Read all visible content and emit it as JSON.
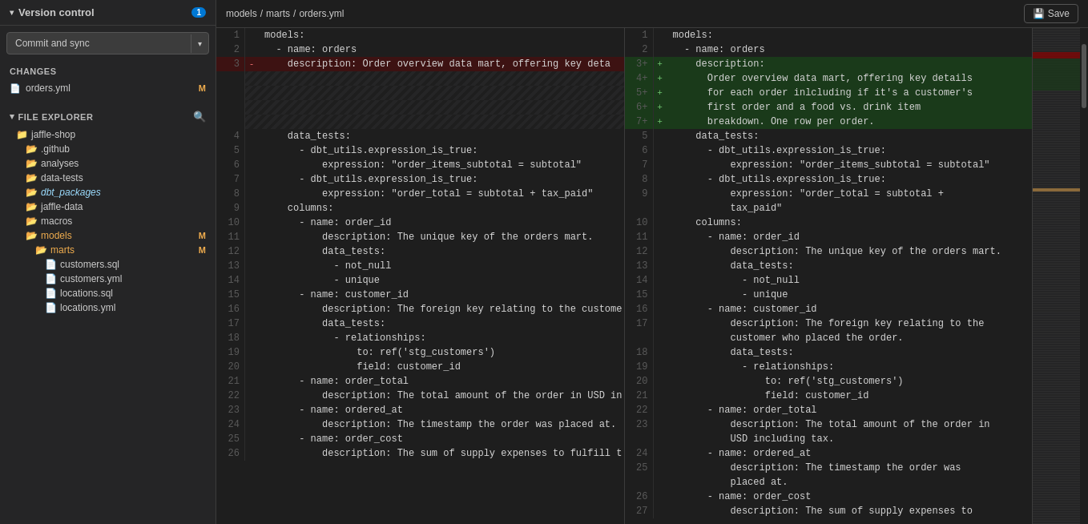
{
  "sidebar": {
    "title": "Version control",
    "badge": "1",
    "commit_button": "Commit and sync",
    "chevron": "▾",
    "changes_label": "Changes",
    "files": [
      {
        "name": "orders.yml",
        "badge": "M",
        "icon": "📄"
      }
    ]
  },
  "file_explorer": {
    "title": "File explorer",
    "search_icon": "🔍",
    "items": [
      {
        "label": "jaffle-shop",
        "type": "folder",
        "indent": 1
      },
      {
        "label": ".github",
        "type": "folder",
        "indent": 2
      },
      {
        "label": "analyses",
        "type": "folder",
        "indent": 2
      },
      {
        "label": "data-tests",
        "type": "folder",
        "indent": 2
      },
      {
        "label": "dbt_packages",
        "type": "folder",
        "indent": 2,
        "italic": true
      },
      {
        "label": "jaffle-data",
        "type": "folder",
        "indent": 2
      },
      {
        "label": "macros",
        "type": "folder",
        "indent": 2
      },
      {
        "label": "models",
        "type": "folder",
        "indent": 2,
        "badge": "M"
      },
      {
        "label": "marts",
        "type": "folder",
        "indent": 3,
        "badge": "M"
      },
      {
        "label": "customers.sql",
        "type": "sql",
        "indent": 4
      },
      {
        "label": "customers.yml",
        "type": "yaml",
        "indent": 4
      },
      {
        "label": "locations.sql",
        "type": "sql",
        "indent": 4
      },
      {
        "label": "locations.yml",
        "type": "yaml",
        "indent": 4
      }
    ]
  },
  "breadcrumb": {
    "parts": [
      "models",
      "marts",
      "orders.yml"
    ]
  },
  "save_button": "Save",
  "diff": {
    "left": {
      "lines": [
        {
          "num": 1,
          "content": "models:",
          "type": "normal"
        },
        {
          "num": 2,
          "content": "  - name: orders",
          "type": "normal"
        },
        {
          "num": 3,
          "content": "    description: Order overview data mart, offering key deta",
          "type": "removed",
          "marker": "-"
        },
        {
          "num": "",
          "content": "",
          "type": "placeholder"
        },
        {
          "num": "",
          "content": "",
          "type": "placeholder"
        },
        {
          "num": "",
          "content": "",
          "type": "placeholder"
        },
        {
          "num": "",
          "content": "",
          "type": "placeholder"
        },
        {
          "num": 4,
          "content": "    data_tests:",
          "type": "normal"
        },
        {
          "num": 5,
          "content": "      - dbt_utils.expression_is_true:",
          "type": "normal"
        },
        {
          "num": 6,
          "content": "          expression: \"order_items_subtotal = subtotal\"",
          "type": "normal"
        },
        {
          "num": 7,
          "content": "      - dbt_utils.expression_is_true:",
          "type": "normal"
        },
        {
          "num": 8,
          "content": "          expression: \"order_total = subtotal + tax_paid\"",
          "type": "normal"
        },
        {
          "num": 9,
          "content": "    columns:",
          "type": "normal"
        },
        {
          "num": 10,
          "content": "      - name: order_id",
          "type": "normal"
        },
        {
          "num": 11,
          "content": "          description: The unique key of the orders mart.",
          "type": "normal"
        },
        {
          "num": 12,
          "content": "          data_tests:",
          "type": "normal"
        },
        {
          "num": 13,
          "content": "            - not_null",
          "type": "normal"
        },
        {
          "num": 14,
          "content": "            - unique",
          "type": "normal"
        },
        {
          "num": 15,
          "content": "      - name: customer_id",
          "type": "normal"
        },
        {
          "num": 16,
          "content": "          description: The foreign key relating to the custome",
          "type": "normal"
        },
        {
          "num": 17,
          "content": "          data_tests:",
          "type": "normal"
        },
        {
          "num": 18,
          "content": "            - relationships:",
          "type": "normal"
        },
        {
          "num": 19,
          "content": "                to: ref('stg_customers')",
          "type": "normal"
        },
        {
          "num": 20,
          "content": "                field: customer_id",
          "type": "normal"
        },
        {
          "num": 21,
          "content": "      - name: order_total",
          "type": "normal"
        },
        {
          "num": 22,
          "content": "          description: The total amount of the order in USD in",
          "type": "normal"
        },
        {
          "num": 23,
          "content": "      - name: ordered_at",
          "type": "normal"
        },
        {
          "num": 24,
          "content": "          description: The timestamp the order was placed at.",
          "type": "normal"
        },
        {
          "num": 25,
          "content": "      - name: order_cost",
          "type": "normal"
        },
        {
          "num": 26,
          "content": "          description: The sum of supply expenses to fulfill t",
          "type": "normal"
        }
      ]
    },
    "right": {
      "lines": [
        {
          "num": 1,
          "content": "models:",
          "type": "normal"
        },
        {
          "num": 2,
          "content": "  - name: orders",
          "type": "normal"
        },
        {
          "num": "3+",
          "content": "    description:",
          "type": "added",
          "marker": "+"
        },
        {
          "num": "4+",
          "content": "      Order overview data mart, offering key details",
          "type": "added",
          "marker": "+"
        },
        {
          "num": "5+",
          "content": "      for each order inlcluding if it's a customer's",
          "type": "added",
          "marker": "+"
        },
        {
          "num": "6+",
          "content": "      first order and a food vs. drink item",
          "type": "added",
          "marker": "+"
        },
        {
          "num": "7+",
          "content": "      breakdown. One row per order.",
          "type": "added",
          "marker": "+"
        },
        {
          "num": 5,
          "content": "    data_tests:",
          "type": "normal"
        },
        {
          "num": 6,
          "content": "      - dbt_utils.expression_is_true:",
          "type": "normal"
        },
        {
          "num": 7,
          "content": "          expression: \"order_items_subtotal = subtotal\"",
          "type": "normal"
        },
        {
          "num": 8,
          "content": "      - dbt_utils.expression_is_true:",
          "type": "normal"
        },
        {
          "num": 9,
          "content": "          expression: \"order_total = subtotal +",
          "type": "normal"
        },
        {
          "num": "",
          "content": "          tax_paid\"",
          "type": "normal"
        },
        {
          "num": 10,
          "content": "    columns:",
          "type": "normal"
        },
        {
          "num": 11,
          "content": "      - name: order_id",
          "type": "normal"
        },
        {
          "num": 12,
          "content": "          description: The unique key of the orders mart.",
          "type": "normal"
        },
        {
          "num": 13,
          "content": "          data_tests:",
          "type": "normal"
        },
        {
          "num": 14,
          "content": "            - not_null",
          "type": "normal"
        },
        {
          "num": 15,
          "content": "            - unique",
          "type": "normal"
        },
        {
          "num": 16,
          "content": "      - name: customer_id",
          "type": "normal"
        },
        {
          "num": 17,
          "content": "          description: The foreign key relating to the",
          "type": "normal"
        },
        {
          "num": "",
          "content": "          customer who placed the order.",
          "type": "normal"
        },
        {
          "num": 18,
          "content": "          data_tests:",
          "type": "normal"
        },
        {
          "num": 19,
          "content": "            - relationships:",
          "type": "normal"
        },
        {
          "num": 20,
          "content": "                to: ref('stg_customers')",
          "type": "normal"
        },
        {
          "num": 21,
          "content": "                field: customer_id",
          "type": "normal"
        },
        {
          "num": 22,
          "content": "      - name: order_total",
          "type": "normal"
        },
        {
          "num": 23,
          "content": "          description: The total amount of the order in",
          "type": "normal"
        },
        {
          "num": "",
          "content": "          USD including tax.",
          "type": "normal"
        },
        {
          "num": 24,
          "content": "      - name: ordered_at",
          "type": "normal"
        },
        {
          "num": 25,
          "content": "          description: The timestamp the order was",
          "type": "normal"
        },
        {
          "num": "",
          "content": "          placed at.",
          "type": "normal"
        },
        {
          "num": 26,
          "content": "      - name: order_cost",
          "type": "normal"
        },
        {
          "num": 27,
          "content": "          description: The sum of supply expenses to",
          "type": "normal"
        }
      ]
    }
  }
}
